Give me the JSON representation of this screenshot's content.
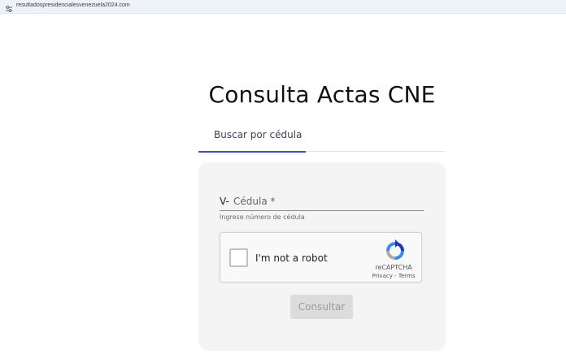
{
  "browser": {
    "url": "resultadospresidencialesvenezuela2024.com",
    "site_info_icon": "tune-icon"
  },
  "page": {
    "title": "Consulta Actas CNE"
  },
  "tabs": [
    {
      "label": "Buscar por cédula",
      "active": true
    }
  ],
  "form": {
    "prefix": "V-",
    "field_label": "Cédula *",
    "hint": "Ingrese número de cédula",
    "captcha": {
      "label": "I'm not a robot",
      "brand": "reCAPTCHA",
      "privacy": "Privacy",
      "separator": " - ",
      "terms": "Terms",
      "checked": false
    },
    "submit_label": "Consultar",
    "submit_enabled": false
  },
  "colors": {
    "accent": "#3f51b5",
    "card_bg": "#f4f4f4",
    "disabled_button": "#dcdcdc"
  }
}
